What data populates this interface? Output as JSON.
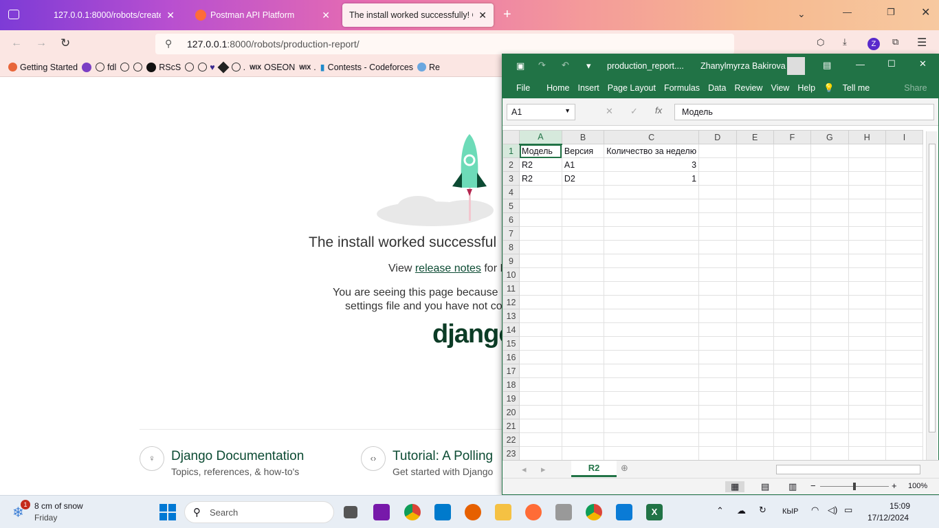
{
  "browser": {
    "tabs": [
      {
        "label": "127.0.0.1:8000/robots/create/"
      },
      {
        "label": "Postman API Platform"
      },
      {
        "label": "The install worked successfully! Con"
      }
    ],
    "url_host": "127.0.0.1",
    "url_rest": ":8000/robots/production-report/",
    "profile_letter": "Z",
    "bookmarks": [
      "Getting Started",
      "fdl",
      "RScS",
      "OSEON",
      "Contests - Codeforces",
      "Re"
    ]
  },
  "django": {
    "heading": "The install worked successful",
    "view_prefix": "View ",
    "release_notes": "release notes",
    "view_suffix": " for D",
    "seeing_line1": "You are seeing this page because D",
    "seeing_line2": "settings file and you have not co",
    "logo": "django",
    "doc_title": "Django Documentation",
    "doc_sub": "Topics, references, & how-to's",
    "tut_title": "Tutorial: A Polling",
    "tut_sub": "Get started with Django"
  },
  "excel": {
    "filename": "production_report....",
    "user": "Zhanylmyrza Bakirova",
    "menu": [
      "File",
      "Home",
      "Insert",
      "Page Layout",
      "Formulas",
      "Data",
      "Review",
      "View",
      "Help",
      "Tell me",
      "Share"
    ],
    "name_box": "A1",
    "formula": "Модель",
    "columns": [
      "A",
      "B",
      "C",
      "D",
      "E",
      "F",
      "G",
      "H",
      "I"
    ],
    "rows": [
      [
        "Модель",
        "Версия",
        "Количество за неделю",
        "",
        "",
        "",
        "",
        "",
        ""
      ],
      [
        "R2",
        "A1",
        "3",
        "",
        "",
        "",
        "",
        "",
        ""
      ],
      [
        "R2",
        "D2",
        "1",
        "",
        "",
        "",
        "",
        "",
        ""
      ]
    ],
    "row_count": 23,
    "sheet_tab": "R2",
    "zoom": "100%"
  },
  "taskbar": {
    "weather_temp": "8 cm of snow",
    "weather_day": "Friday",
    "notif_count": "1",
    "search": "Search",
    "lang": "КЫР",
    "time": "15:09",
    "date": "17/12/2024"
  }
}
